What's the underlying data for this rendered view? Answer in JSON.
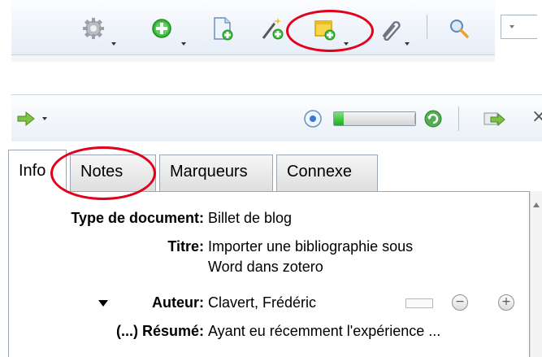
{
  "toolbar": {
    "items": [
      "actions",
      "new-item",
      "new-item-from-file",
      "add-by-identifier",
      "new-note",
      "add-attachment",
      "search"
    ]
  },
  "item_pane": {
    "header": {
      "sync_progress": 0.12
    },
    "tabs": [
      {
        "label": "Info",
        "active": true
      },
      {
        "label": "Notes",
        "active": false
      },
      {
        "label": "Marqueurs",
        "active": false
      },
      {
        "label": "Connexe",
        "active": false
      }
    ],
    "fields": {
      "type_label": "Type de document:",
      "type_value": "Billet de blog",
      "title_label": "Titre:",
      "title_line1": "Importer une bibliographie sous",
      "title_line2": "Word dans zotero",
      "author_label": "Auteur:",
      "author_value": "Clavert, Frédéric",
      "abstract_label": "(...) Résumé:",
      "abstract_value": "Ayant eu récemment l'expérience ..."
    }
  },
  "colors": {
    "annotation": "#e3001b",
    "toolbar_bg": "#e6eef8"
  }
}
